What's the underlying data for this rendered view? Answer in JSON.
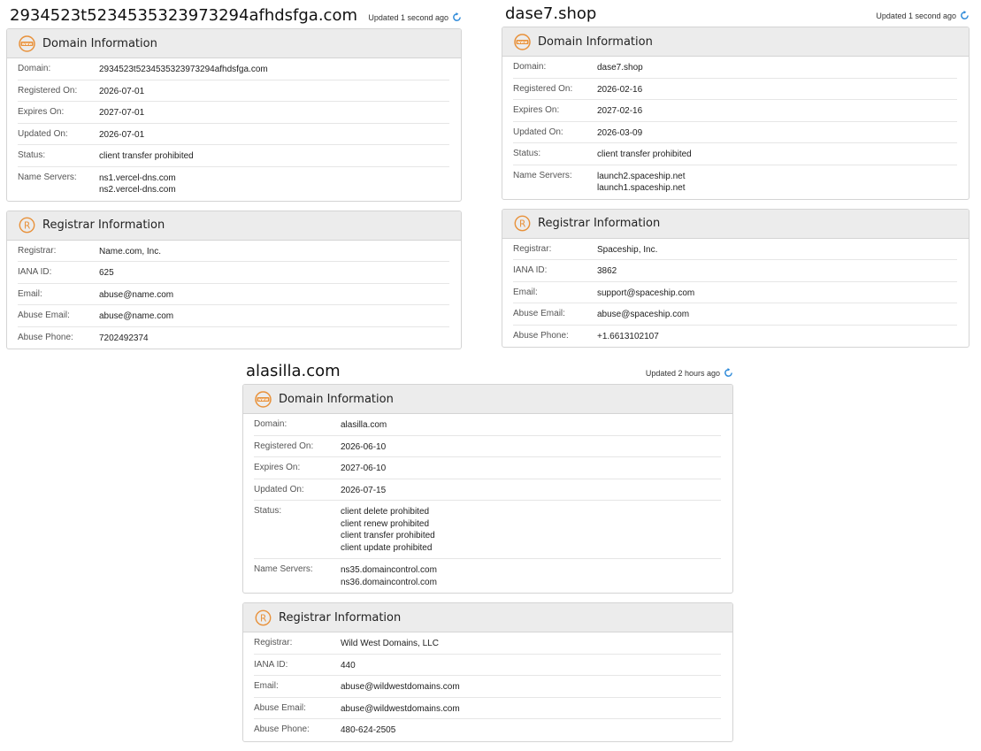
{
  "reports": [
    {
      "domain_name": "2934523t5234535323973294afhdsfga.com",
      "updated": "Updated 1 second ago",
      "domain_info": {
        "title": "Domain Information",
        "rows": [
          {
            "label": "Domain:",
            "values": [
              "2934523t5234535323973294afhdsfga.com"
            ]
          },
          {
            "label": "Registered On:",
            "values": [
              "2026-07-01"
            ]
          },
          {
            "label": "Expires On:",
            "values": [
              "2027-07-01"
            ]
          },
          {
            "label": "Updated On:",
            "values": [
              "2026-07-01"
            ]
          },
          {
            "label": "Status:",
            "values": [
              "client transfer prohibited"
            ]
          },
          {
            "label": "Name Servers:",
            "values": [
              "ns1.vercel-dns.com",
              "ns2.vercel-dns.com"
            ]
          }
        ]
      },
      "registrar_info": {
        "title": "Registrar Information",
        "rows": [
          {
            "label": "Registrar:",
            "values": [
              "Name.com, Inc."
            ]
          },
          {
            "label": "IANA ID:",
            "values": [
              "625"
            ]
          },
          {
            "label": "Email:",
            "values": [
              "abuse@name.com"
            ]
          },
          {
            "label": "Abuse Email:",
            "values": [
              "abuse@name.com"
            ]
          },
          {
            "label": "Abuse Phone:",
            "values": [
              "7202492374"
            ]
          }
        ]
      }
    },
    {
      "domain_name": "dase7.shop",
      "updated": "Updated 1 second ago",
      "domain_info": {
        "title": "Domain Information",
        "rows": [
          {
            "label": "Domain:",
            "values": [
              "dase7.shop"
            ]
          },
          {
            "label": "Registered On:",
            "values": [
              "2026-02-16"
            ]
          },
          {
            "label": "Expires On:",
            "values": [
              "2027-02-16"
            ]
          },
          {
            "label": "Updated On:",
            "values": [
              "2026-03-09"
            ]
          },
          {
            "label": "Status:",
            "values": [
              "client transfer prohibited"
            ]
          },
          {
            "label": "Name Servers:",
            "values": [
              "launch2.spaceship.net",
              "launch1.spaceship.net"
            ]
          }
        ]
      },
      "registrar_info": {
        "title": "Registrar Information",
        "rows": [
          {
            "label": "Registrar:",
            "values": [
              "Spaceship, Inc."
            ]
          },
          {
            "label": "IANA ID:",
            "values": [
              "3862"
            ]
          },
          {
            "label": "Email:",
            "values": [
              "support@spaceship.com"
            ]
          },
          {
            "label": "Abuse Email:",
            "values": [
              "abuse@spaceship.com"
            ]
          },
          {
            "label": "Abuse Phone:",
            "values": [
              "+1.6613102107"
            ]
          }
        ]
      }
    },
    {
      "domain_name": "alasilla.com",
      "updated": "Updated 2 hours ago",
      "domain_info": {
        "title": "Domain Information",
        "rows": [
          {
            "label": "Domain:",
            "values": [
              "alasilla.com"
            ]
          },
          {
            "label": "Registered On:",
            "values": [
              "2026-06-10"
            ]
          },
          {
            "label": "Expires On:",
            "values": [
              "2027-06-10"
            ]
          },
          {
            "label": "Updated On:",
            "values": [
              "2026-07-15"
            ]
          },
          {
            "label": "Status:",
            "values": [
              "client delete prohibited",
              "client renew prohibited",
              "client transfer prohibited",
              "client update prohibited"
            ]
          },
          {
            "label": "Name Servers:",
            "values": [
              "ns35.domaincontrol.com",
              "ns36.domaincontrol.com"
            ]
          }
        ]
      },
      "registrar_info": {
        "title": "Registrar Information",
        "rows": [
          {
            "label": "Registrar:",
            "values": [
              "Wild West Domains, LLC"
            ]
          },
          {
            "label": "IANA ID:",
            "values": [
              "440"
            ]
          },
          {
            "label": "Email:",
            "values": [
              "abuse@wildwestdomains.com"
            ]
          },
          {
            "label": "Abuse Email:",
            "values": [
              "abuse@wildwestdomains.com"
            ]
          },
          {
            "label": "Abuse Phone:",
            "values": [
              "480-624-2505"
            ]
          }
        ]
      }
    }
  ],
  "colors": {
    "icon_accent": "#e8913a",
    "refresh_accent": "#2a88d8",
    "header_bg": "#ececec"
  },
  "icons": {
    "domain": "www-globe-icon",
    "registrar": "registered-trademark-icon",
    "refresh": "refresh-icon"
  }
}
